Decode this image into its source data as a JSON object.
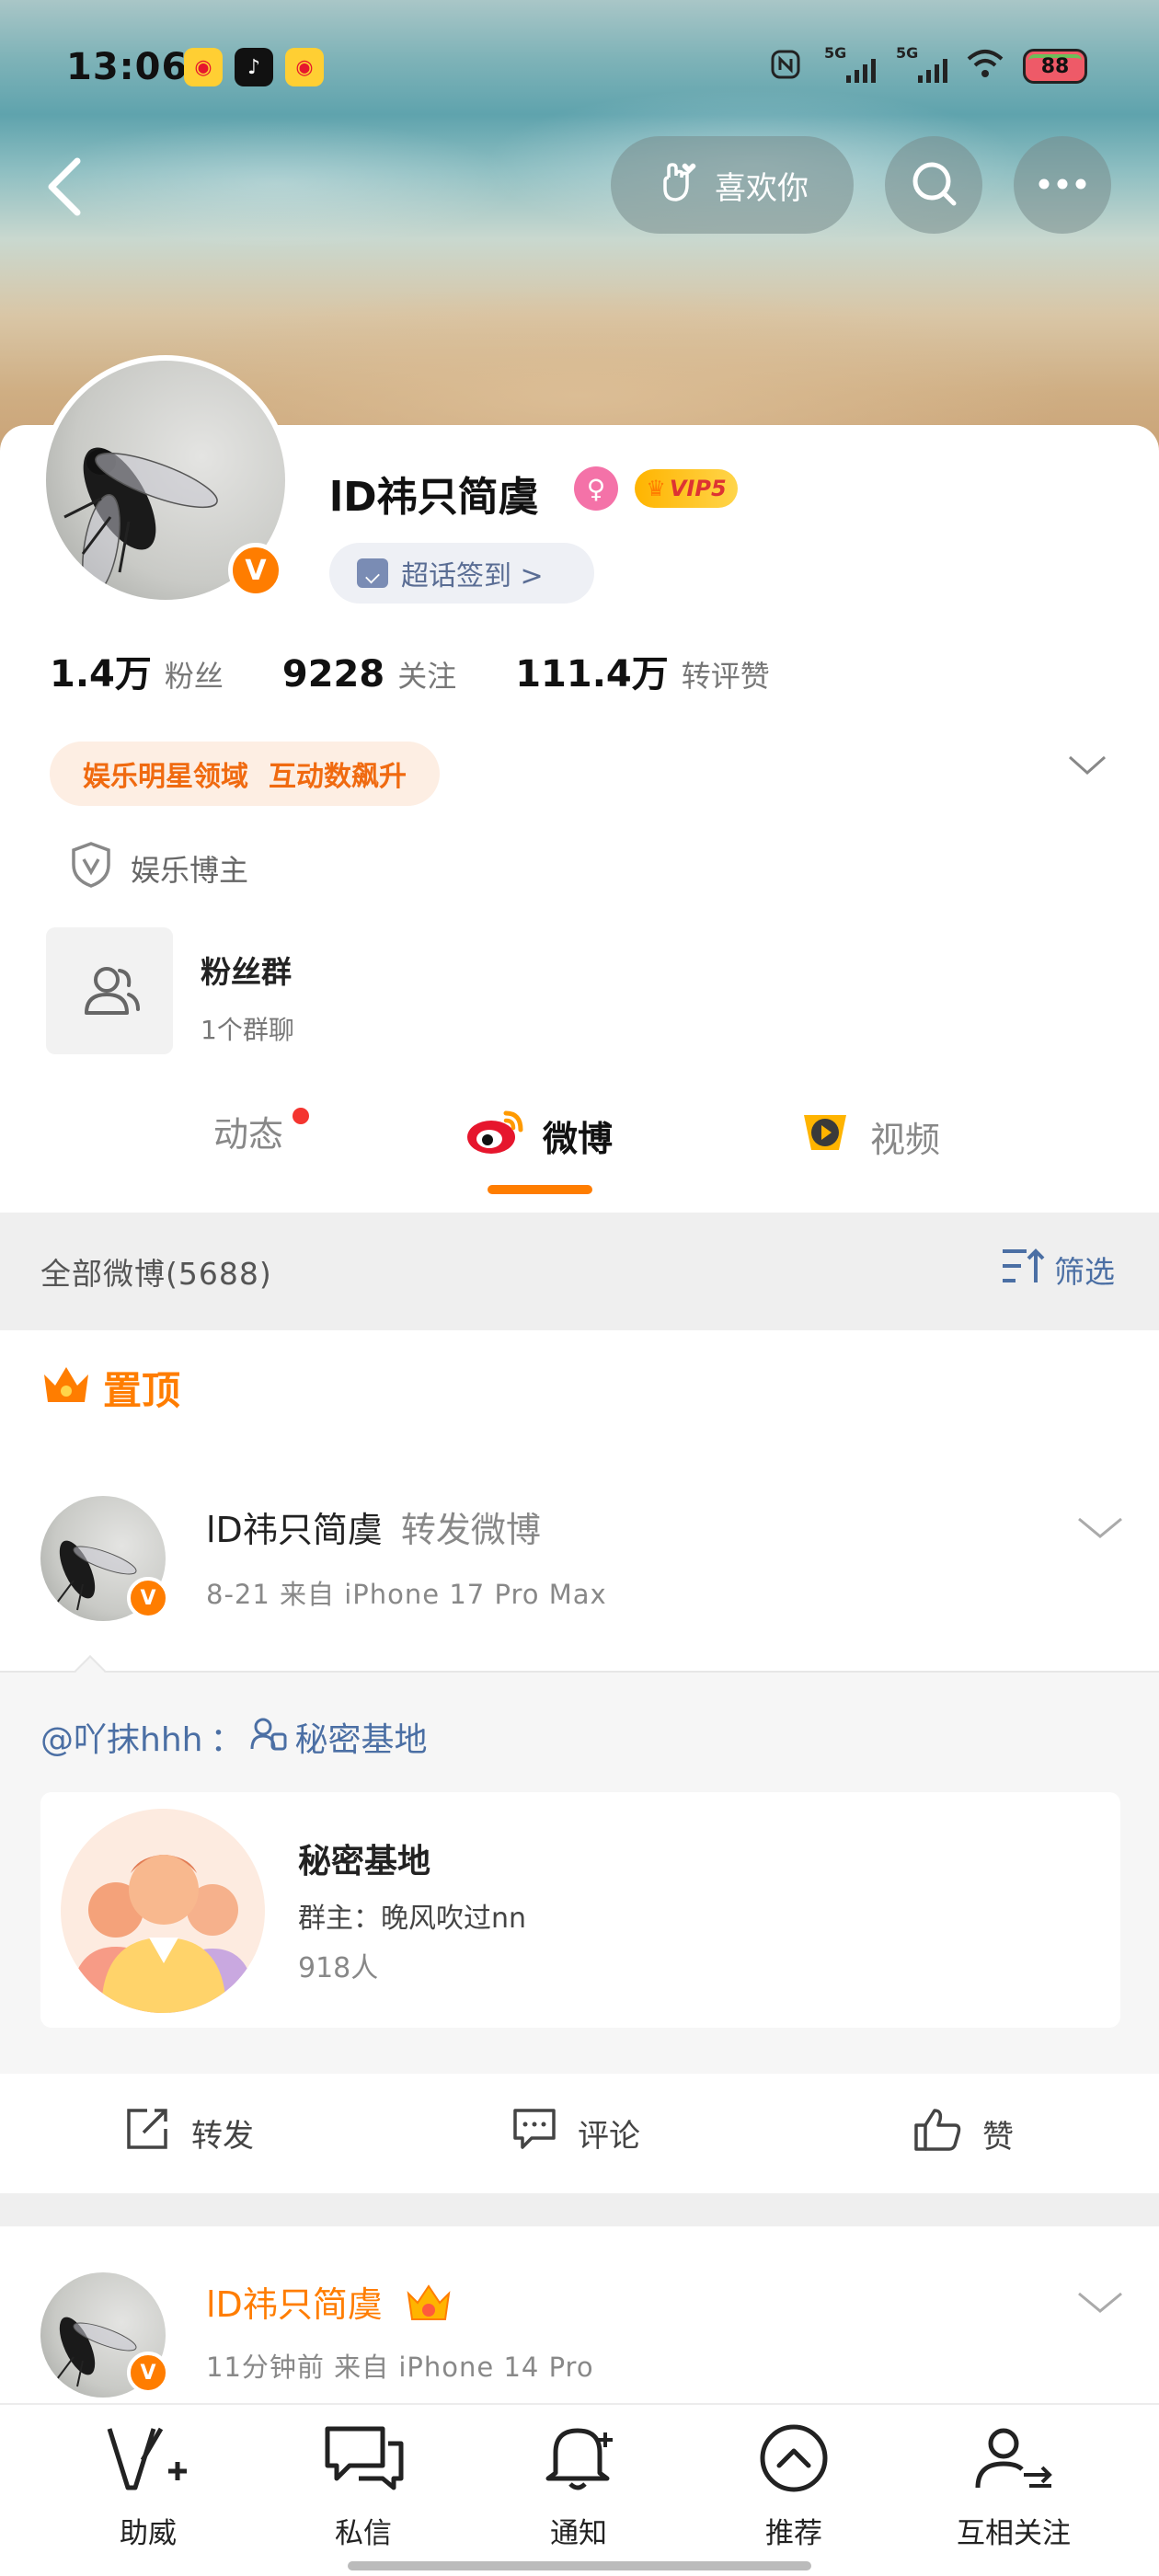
{
  "status_bar": {
    "time": "13:06",
    "network_1": "5G",
    "network_2": "5G",
    "battery": "88"
  },
  "header": {
    "like_button_label": "喜欢你"
  },
  "profile": {
    "name": "lD祎只简虞",
    "vip_label": "VIP5",
    "supertopic_checkin_label": "超话签到 >",
    "stats": [
      {
        "value": "1.4万",
        "label": "粉丝"
      },
      {
        "value": "9228",
        "label": "关注"
      },
      {
        "value": "111.4万",
        "label": "转评赞"
      }
    ],
    "domain_tag_1": "娱乐明星领域",
    "domain_tag_2": "互动数飙升",
    "blogger_label": "娱乐博主",
    "fan_group_title": "粉丝群",
    "fan_group_sub": "1个群聊"
  },
  "tabs": [
    {
      "label": "动态"
    },
    {
      "label": "微博"
    },
    {
      "label": "视频"
    }
  ],
  "filter_bar": {
    "all_count_label": "全部微博(5688)",
    "filter_label": "筛选"
  },
  "pinned_label": "置顶",
  "posts": [
    {
      "name": "lD祎只简虞",
      "action": "转发微博",
      "meta": "8-21  来自 iPhone 17 Pro Max",
      "repost_user": "@吖抹hhh",
      "repost_sep": "：",
      "repost_group": "秘密基地",
      "group_card": {
        "title": "秘密基地",
        "owner": "群主：晚风吹过nn",
        "count": "918人"
      },
      "actions": {
        "repost": "转发",
        "comment": "评论",
        "like": "赞"
      }
    },
    {
      "name": "lD祎只简虞",
      "meta": "11分钟前  来自 iPhone 14 Pro"
    }
  ],
  "bottom_nav": [
    {
      "label": "助威"
    },
    {
      "label": "私信"
    },
    {
      "label": "通知"
    },
    {
      "label": "推荐"
    },
    {
      "label": "互相关注"
    }
  ],
  "colors": {
    "accent": "#ff7d00",
    "link": "#4b6fa4",
    "pink": "#f472a8"
  }
}
